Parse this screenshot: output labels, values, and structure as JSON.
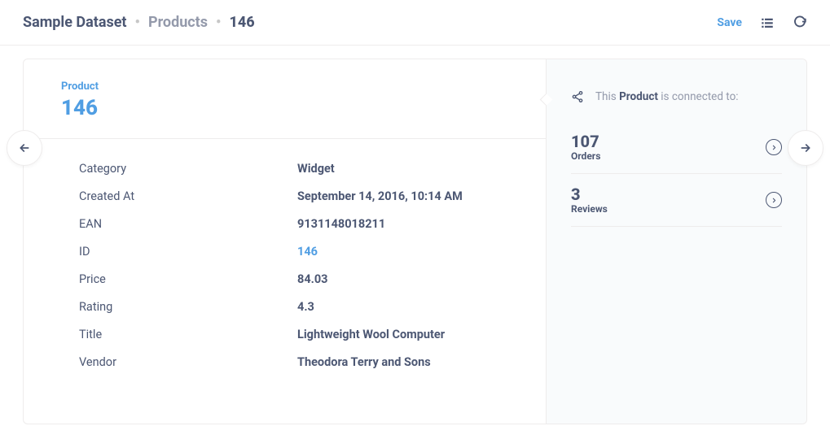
{
  "breadcrumb": {
    "dataset": "Sample Dataset",
    "table": "Products",
    "id": "146"
  },
  "header": {
    "save": "Save"
  },
  "entity": {
    "type_label": "Product",
    "display_id": "146"
  },
  "fields": [
    {
      "label": "Category",
      "value": "Widget",
      "link": false
    },
    {
      "label": "Created At",
      "value": "September 14, 2016, 10:14 AM",
      "link": false
    },
    {
      "label": "EAN",
      "value": "9131148018211",
      "link": false
    },
    {
      "label": "ID",
      "value": "146",
      "link": true
    },
    {
      "label": "Price",
      "value": "84.03",
      "link": false
    },
    {
      "label": "Rating",
      "value": "4.3",
      "link": false
    },
    {
      "label": "Title",
      "value": "Lightweight Wool Computer",
      "link": false
    },
    {
      "label": "Vendor",
      "value": "Theodora Terry and Sons",
      "link": false
    }
  ],
  "connected": {
    "prefix": "This ",
    "entity": "Product",
    "suffix": " is connected to:"
  },
  "related": [
    {
      "count": "107",
      "label": "Orders"
    },
    {
      "count": "3",
      "label": "Reviews"
    }
  ]
}
